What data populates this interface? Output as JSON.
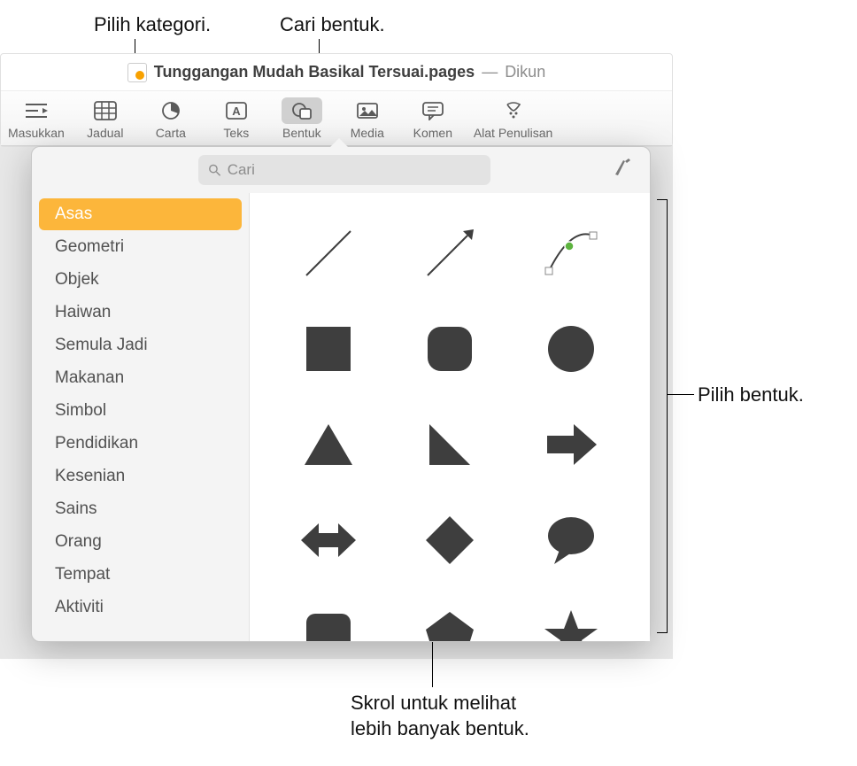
{
  "callouts": {
    "category": "Pilih kategori.",
    "search": "Cari bentuk.",
    "pickShape": "Pilih bentuk.",
    "scroll": "Skrol untuk melihat\nlebih banyak bentuk."
  },
  "window": {
    "titleDoc": "Tunggangan Mudah Basikal Tersuai.pages",
    "titleSep": "—",
    "titleStatus": "Dikun"
  },
  "toolbar": {
    "items": [
      {
        "label": "Masukkan",
        "icon": "insert"
      },
      {
        "label": "Jadual",
        "icon": "table"
      },
      {
        "label": "Carta",
        "icon": "chart"
      },
      {
        "label": "Teks",
        "icon": "text"
      },
      {
        "label": "Bentuk",
        "icon": "shape",
        "active": true
      },
      {
        "label": "Media",
        "icon": "media"
      },
      {
        "label": "Komen",
        "icon": "comment"
      },
      {
        "label": "Alat Penulisan",
        "icon": "writing"
      }
    ]
  },
  "search": {
    "placeholder": "Cari"
  },
  "sidebar": {
    "items": [
      {
        "label": "Asas",
        "selected": true
      },
      {
        "label": "Geometri"
      },
      {
        "label": "Objek"
      },
      {
        "label": "Haiwan"
      },
      {
        "label": "Semula Jadi"
      },
      {
        "label": "Makanan"
      },
      {
        "label": "Simbol"
      },
      {
        "label": "Pendidikan"
      },
      {
        "label": "Kesenian"
      },
      {
        "label": "Sains"
      },
      {
        "label": "Orang"
      },
      {
        "label": "Tempat"
      },
      {
        "label": "Aktiviti"
      }
    ]
  },
  "shapes": [
    "line",
    "arrow-line",
    "curve",
    "square",
    "rounded-square",
    "circle",
    "triangle",
    "right-triangle",
    "arrow-right",
    "arrow-bidir",
    "diamond",
    "speech-bubble",
    "callout-box",
    "pentagon",
    "star"
  ],
  "colors": {
    "shapeFill": "#3e3e3e",
    "selection": "#fcb63b",
    "curveHandle": "#5db33f"
  }
}
